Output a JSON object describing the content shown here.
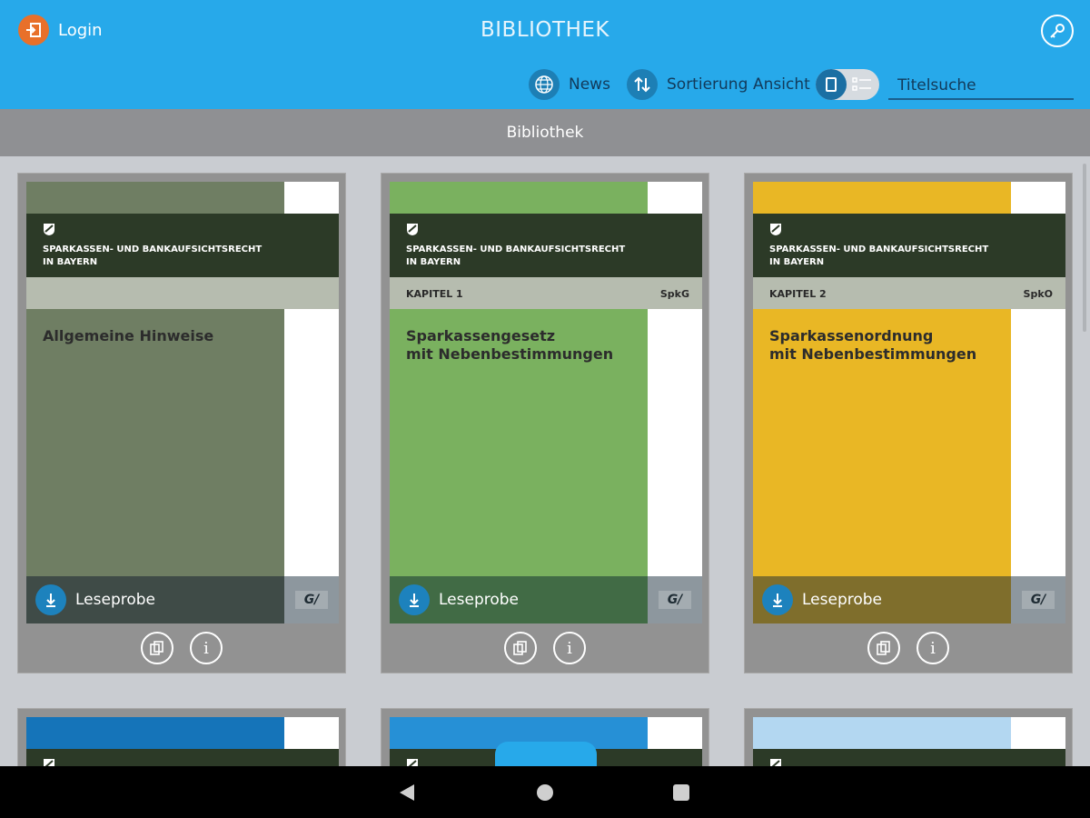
{
  "header": {
    "login_label": "Login",
    "title": "BIBLIOTHEK",
    "login_icon": "login-icon",
    "key_icon": "key-icon"
  },
  "toolbar": {
    "news_label": "News",
    "sort_label": "Sortierung",
    "view_label": "Ansicht",
    "search_placeholder": "Titelsuche"
  },
  "section": {
    "title": "Bibliothek"
  },
  "cards": [
    {
      "color": "#6f7e63",
      "band_line1": "SPARKASSEN- UND BANKAUFSICHTSRECHT",
      "band_line2": "IN BAYERN",
      "chapter": "",
      "abbr": "",
      "title": "Allgemeine Hinweise",
      "footer_color": "#3f4b47",
      "lese_label": "Leseprobe",
      "gv": "G/"
    },
    {
      "color": "#7ab15f",
      "band_line1": "SPARKASSEN- UND BANKAUFSICHTSRECHT",
      "band_line2": "IN BAYERN",
      "chapter": "KAPITEL 1",
      "abbr": "SpkG",
      "title": "Sparkassengesetz\nmit Nebenbestimmungen",
      "footer_color": "#416b45",
      "lese_label": "Leseprobe",
      "gv": "G/"
    },
    {
      "color": "#e9b725",
      "band_line1": "SPARKASSEN- UND BANKAUFSICHTSRECHT",
      "band_line2": "IN BAYERN",
      "chapter": "KAPITEL 2",
      "abbr": "SpkO",
      "title": "Sparkassenordnung\nmit Nebenbestimmungen",
      "footer_color": "#7f6e2c",
      "lese_label": "Leseprobe",
      "gv": "G/"
    }
  ],
  "partial_cards": [
    {
      "color": "#1574b9"
    },
    {
      "color": "#2690d6"
    },
    {
      "color": "#b3d7f1"
    }
  ]
}
